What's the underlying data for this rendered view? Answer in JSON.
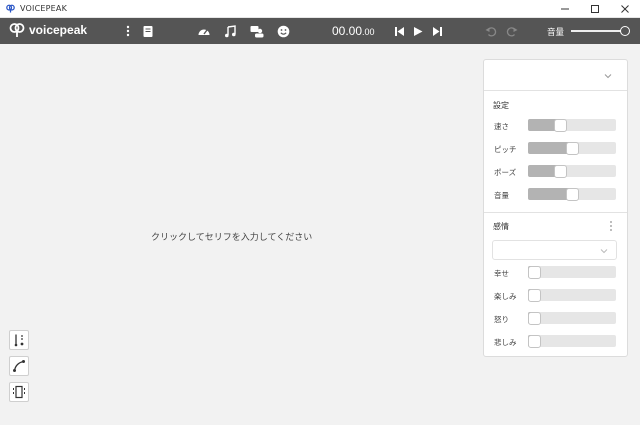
{
  "window": {
    "title": "VOICEPEAK"
  },
  "toolbar": {
    "logo_text": "voicepeak",
    "timecode_main": "00.00",
    "timecode_small": ".00",
    "volume_label": "音量",
    "volume_level": 1.0
  },
  "editor": {
    "placeholder": "クリックしてセリフを入力してください"
  },
  "panel": {
    "preset_value": "",
    "settings_title": "設定",
    "settings": [
      {
        "label": "速さ",
        "value": 0.35
      },
      {
        "label": "ピッチ",
        "value": 0.5
      },
      {
        "label": "ポーズ",
        "value": 0.35
      },
      {
        "label": "音量",
        "value": 0.5
      }
    ],
    "emotion_title": "感情",
    "emotion_select_value": "",
    "emotions": [
      {
        "label": "幸せ",
        "value": 0
      },
      {
        "label": "楽しみ",
        "value": 0
      },
      {
        "label": "怒り",
        "value": 0
      },
      {
        "label": "悲しみ",
        "value": 0
      }
    ]
  },
  "colors": {
    "toolbar_bg": "#555555",
    "canvas_bg": "#f2f2f2",
    "slider_fill": "#b3b3b3",
    "slider_track": "#e6e6e6"
  },
  "icons": [
    "app-logo-icon",
    "minimize-icon",
    "maximize-icon",
    "close-icon",
    "more-vert-icon",
    "dictionary-icon",
    "speed-icon",
    "music-note-icon",
    "narrator-icon",
    "emotion-face-icon",
    "skip-back-icon",
    "play-icon",
    "skip-forward-icon",
    "undo-icon",
    "redo-icon",
    "chevron-down-icon",
    "split-tool-icon",
    "curve-tool-icon",
    "frame-tool-icon"
  ]
}
